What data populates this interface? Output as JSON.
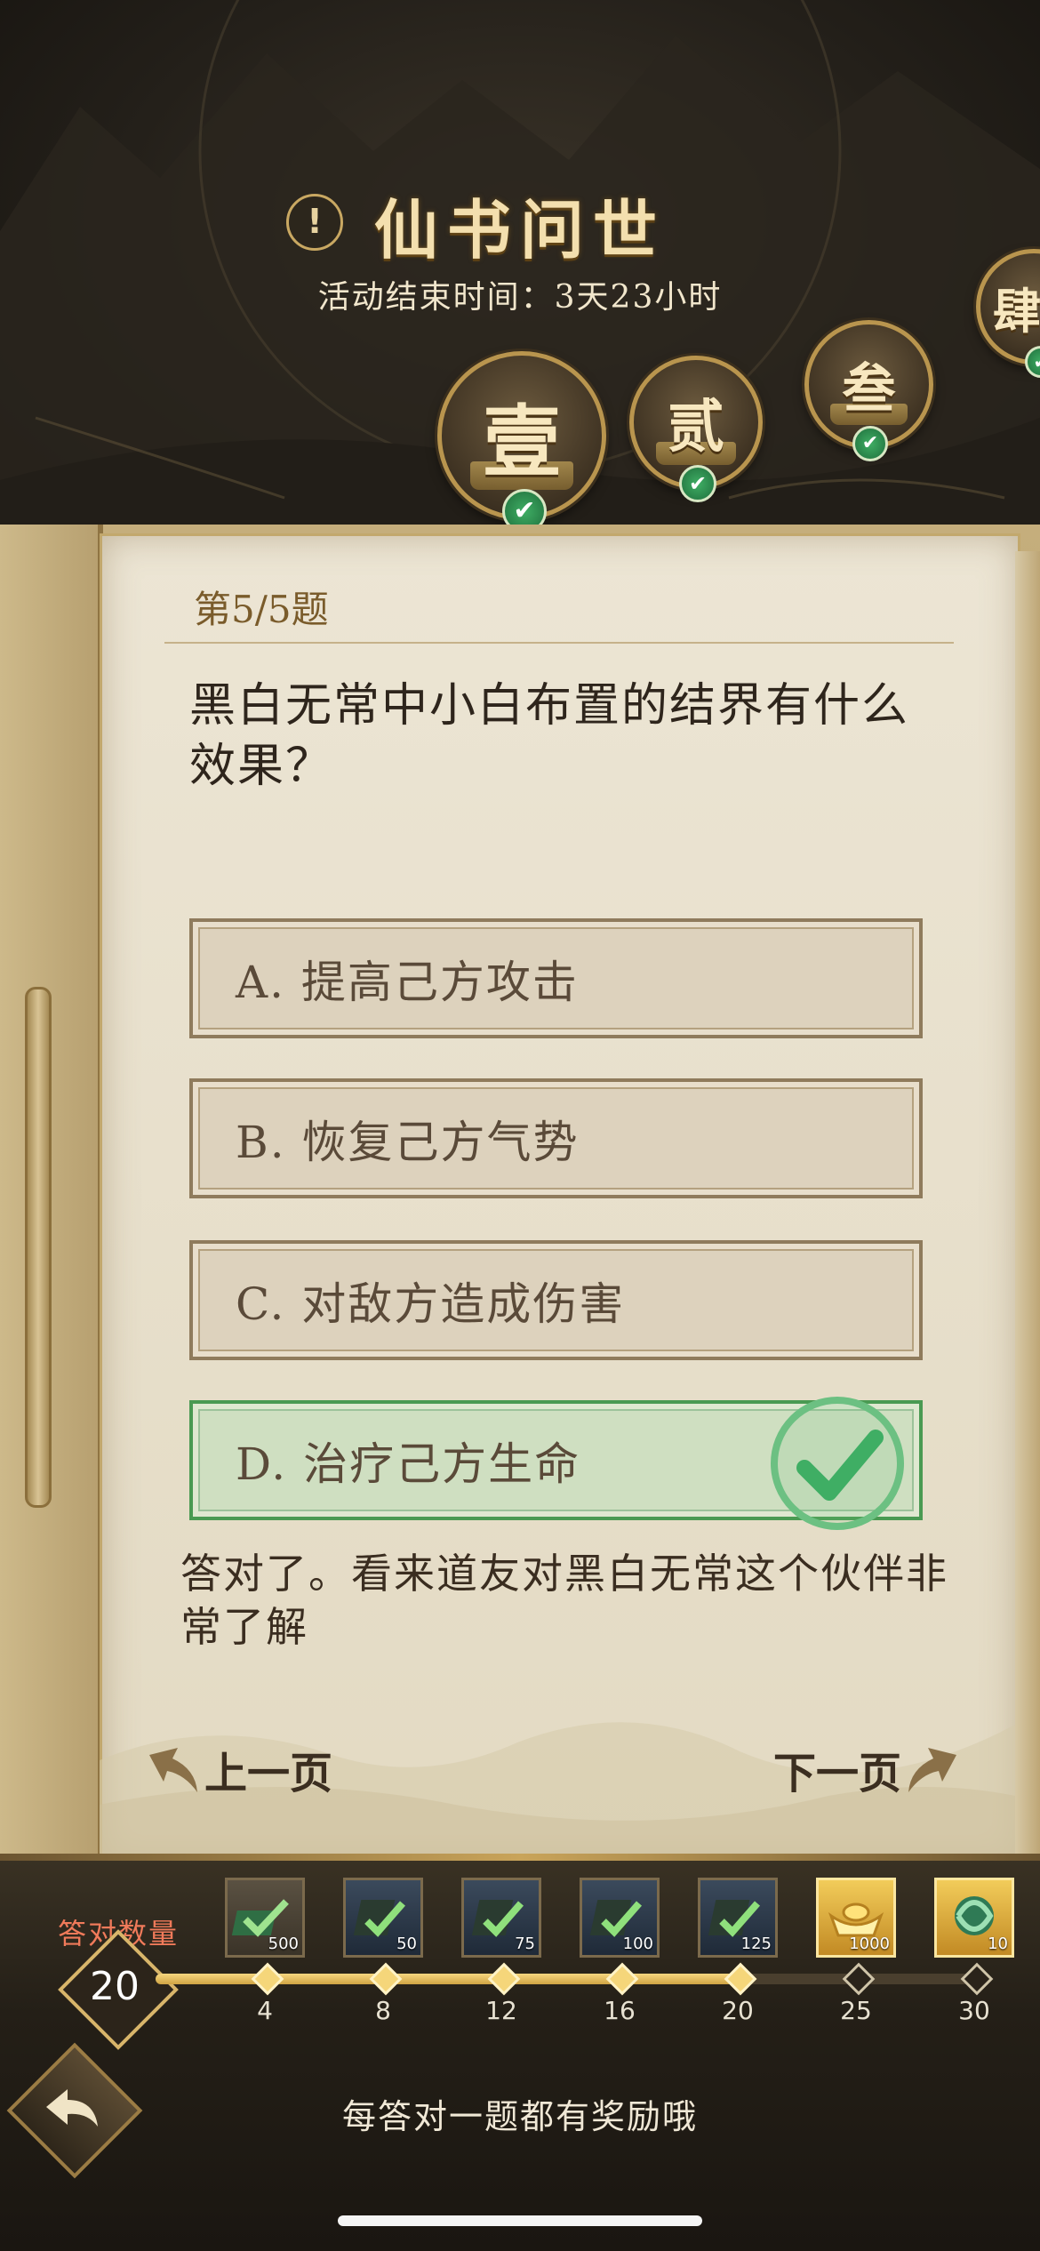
{
  "event": {
    "title": "仙书问世",
    "end_time": "活动结束时间：3天23小时",
    "info_icon": "!"
  },
  "chapters": [
    {
      "glyph": "壹",
      "completed": true,
      "active": true
    },
    {
      "glyph": "贰",
      "completed": true,
      "active": false
    },
    {
      "glyph": "叁",
      "completed": true,
      "active": false
    },
    {
      "glyph": "肆",
      "completed": true,
      "active": false
    }
  ],
  "quiz": {
    "number": "第5/5题",
    "question": "黑白无常中小白布置的结界有什么效果？",
    "options": [
      {
        "label": "A. 提高己方攻击",
        "correct": false
      },
      {
        "label": "B. 恢复己方气势",
        "correct": false
      },
      {
        "label": "C. 对敌方造成伤害",
        "correct": false
      },
      {
        "label": "D. 治疗己方生命",
        "correct": true
      }
    ],
    "feedback": "答对了。看来道友对黑白无常这个伙伴非常了解",
    "prev_label": "上一页",
    "next_label": "下一页"
  },
  "progress": {
    "label": "答对数量",
    "count": "20",
    "current_value": 20,
    "max_value": 30,
    "milestones": [
      "4",
      "8",
      "12",
      "16",
      "20",
      "25",
      "30"
    ],
    "rewards": [
      {
        "qty": "500",
        "icon": "book-reward-icon"
      },
      {
        "qty": "50",
        "icon": "book-reward-icon"
      },
      {
        "qty": "75",
        "icon": "book-reward-icon"
      },
      {
        "qty": "100",
        "icon": "book-reward-icon"
      },
      {
        "qty": "125",
        "icon": "book-reward-icon"
      },
      {
        "qty": "1000",
        "icon": "gold-ingot-icon"
      },
      {
        "qty": "10",
        "icon": "jade-dragon-icon"
      }
    ]
  },
  "hint": "每答对一题都有奖励哦",
  "colors": {
    "accent_gold": "#d8b56a",
    "correct_green": "#4a9a52",
    "progress_label": "#f07a5a"
  }
}
